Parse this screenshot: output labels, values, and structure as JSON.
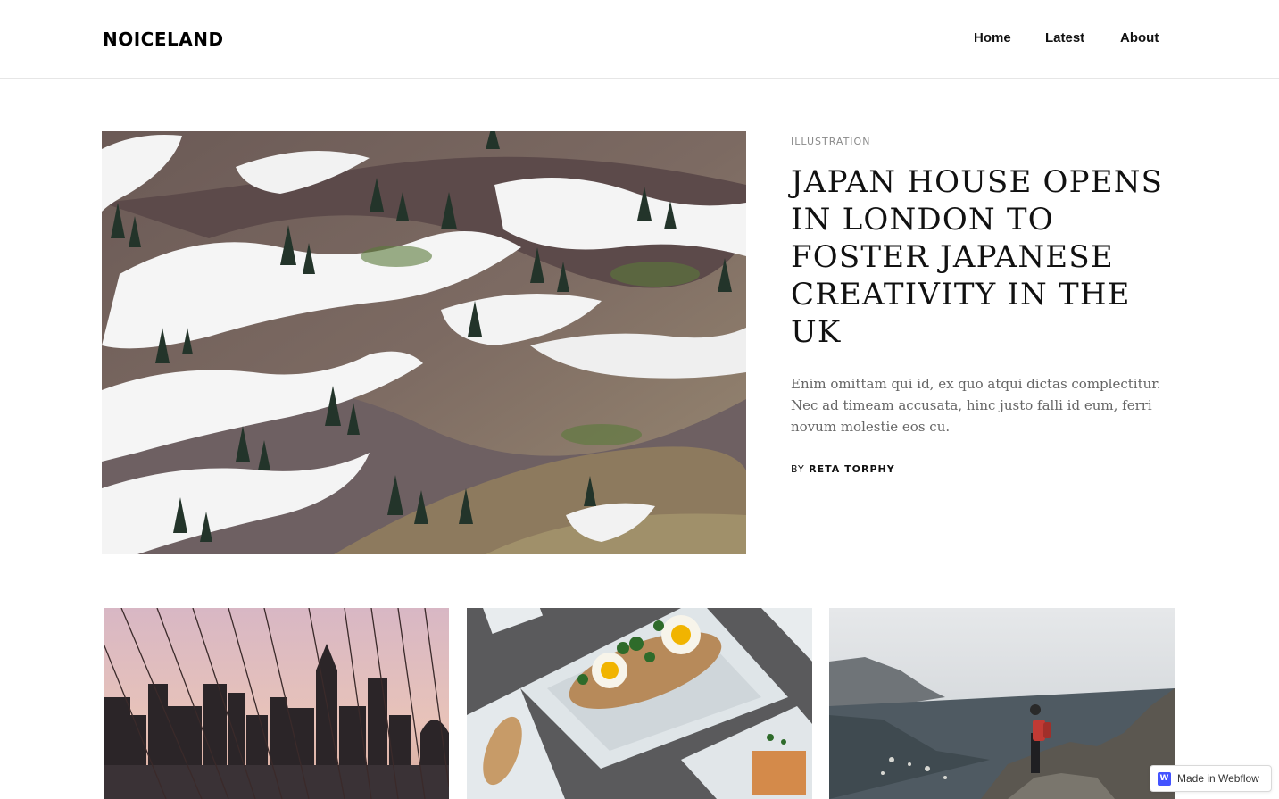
{
  "header": {
    "logo": "NOICELAND",
    "nav": [
      {
        "label": "Home"
      },
      {
        "label": "Latest"
      },
      {
        "label": "About"
      }
    ]
  },
  "featured": {
    "category": "ILLUSTRATION",
    "title": "JAPAN HOUSE OPENS IN LONDON TO FOSTER JAPANESE CREATIVITY IN THE UK",
    "excerpt": "Enim omittam qui id, ex quo atqui dictas complectitur. Nec ad timeam accusata, hinc justo falli id eum, ferri novum molestie eos cu.",
    "byline_prefix": "BY",
    "author": "RETA TORPHY"
  },
  "badge": {
    "logo_letter": "W",
    "text": "Made in Webflow"
  },
  "icons": [
    "webflow-logo-icon"
  ]
}
